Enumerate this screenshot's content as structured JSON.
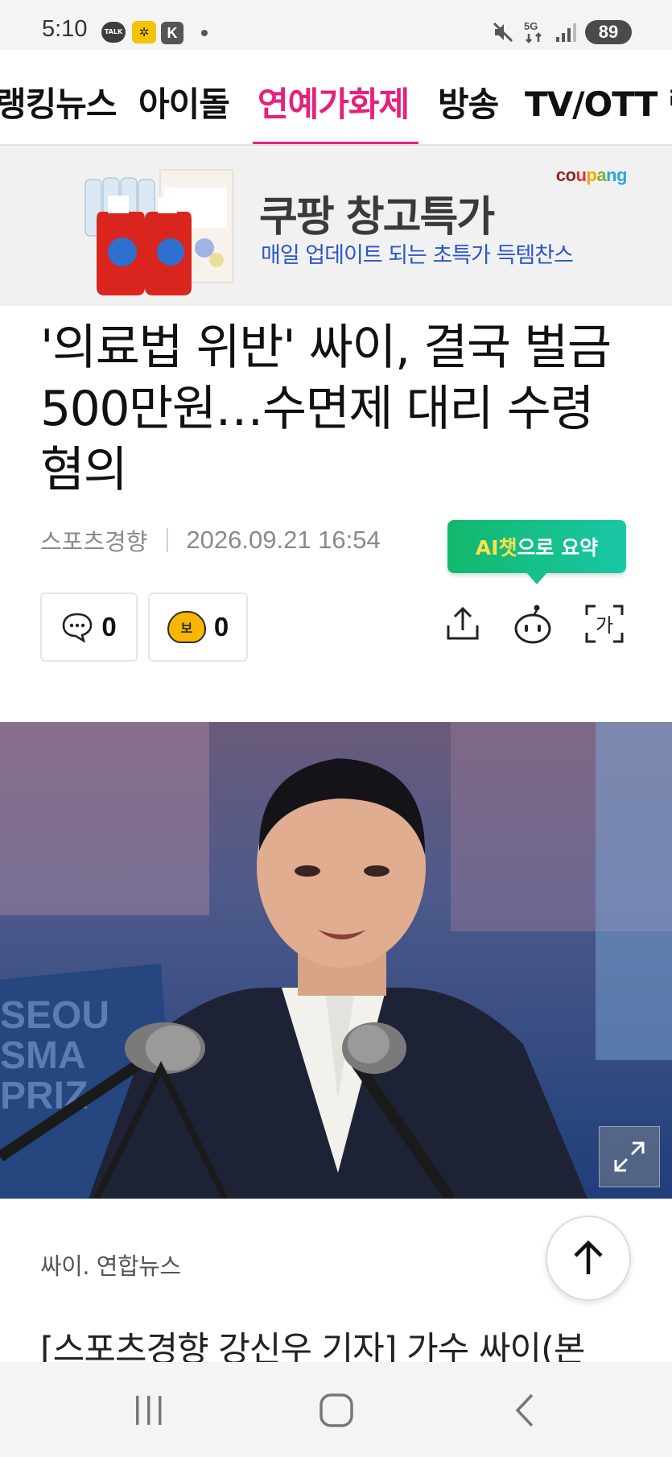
{
  "status_bar": {
    "time": "5:10",
    "talk_label": "TALK",
    "k_label": "K",
    "network": "5G",
    "battery": "89"
  },
  "nav_tabs": [
    {
      "label": "랭킹뉴스",
      "active": false
    },
    {
      "label": "아이돌",
      "active": false
    },
    {
      "label": "연예가화제",
      "active": true
    },
    {
      "label": "방송",
      "active": false
    },
    {
      "label": "TV/OTT 랭",
      "active": false
    }
  ],
  "ad": {
    "brand": "coupang",
    "brand_colors": [
      "#8b2a1f",
      "#e0332b",
      "#f2a600",
      "#79b52b",
      "#2aa7d9"
    ],
    "title": "쿠팡 창고특가",
    "subtitle": "매일 업데이트 되는 초특가 득템찬스"
  },
  "article": {
    "headline": "'의료법 위반' 싸이, 결국 벌금 500만원…수면제 대리 수령 혐의",
    "source": "스포츠경향",
    "datetime": "2026.09.21 16:54",
    "ai_summary": {
      "highlight": "AI챗",
      "rest": "으로 요약"
    },
    "comment_count": "0",
    "emotion_label": "보",
    "emotion_count": "0",
    "font_size_icon_label": "가",
    "photo_caption": "싸이. 연합뉴스",
    "body_first_line": "[스포츠경향 강신우 기자] 가수 싸이(본"
  },
  "colors": {
    "accent": "#e6207c",
    "ai_green": "#12b86c",
    "ad_blue": "#2b57c9"
  }
}
